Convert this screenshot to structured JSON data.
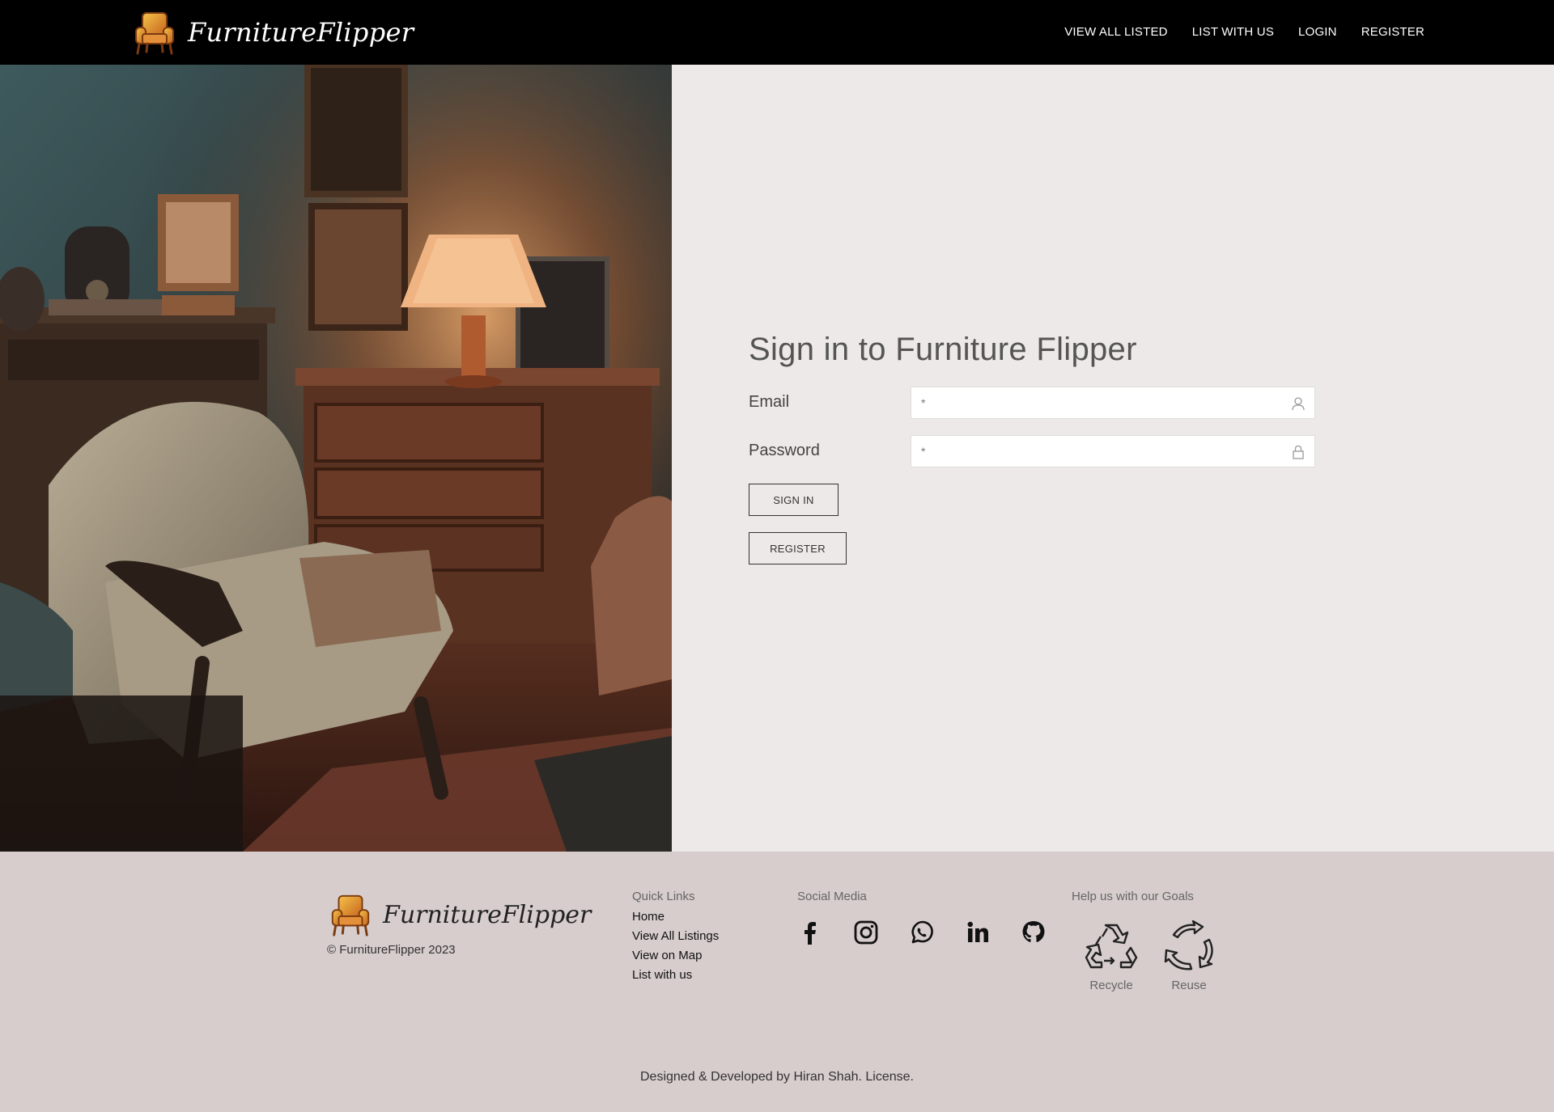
{
  "header": {
    "brand": "FurnitureFlipper",
    "nav": [
      {
        "label": "VIEW ALL LISTED"
      },
      {
        "label": "LIST WITH US"
      },
      {
        "label": "LOGIN"
      },
      {
        "label": "REGISTER"
      }
    ]
  },
  "signin": {
    "title": "Sign in to Furniture Flipper",
    "email": {
      "label": "Email",
      "placeholder": "*",
      "icon": "user-icon"
    },
    "password": {
      "label": "Password",
      "placeholder": "*",
      "icon": "lock-icon"
    },
    "signin_button": "SIGN IN",
    "register_button": "REGISTER"
  },
  "footer": {
    "brand": "FurnitureFlipper",
    "copyright": "© FurnitureFlipper 2023",
    "quick_links": {
      "title": "Quick Links",
      "items": [
        "Home",
        "View All Listings",
        "View on Map",
        "List with us"
      ]
    },
    "social": {
      "title": "Social Media",
      "icons": [
        "facebook-icon",
        "instagram-icon",
        "whatsapp-icon",
        "linkedin-icon",
        "github-icon"
      ]
    },
    "goals": {
      "title": "Help us with our Goals",
      "items": [
        {
          "label": "Recycle",
          "icon": "recycle-icon"
        },
        {
          "label": "Reuse",
          "icon": "reuse-icon"
        }
      ]
    },
    "credit": "Designed & Developed by Hiran Shah. License."
  },
  "colors": {
    "navbar": "#000000",
    "hero_bg": "#ede9e8",
    "footer_bg": "#d6cdcc",
    "lamp_glow": "#e8a66a"
  }
}
